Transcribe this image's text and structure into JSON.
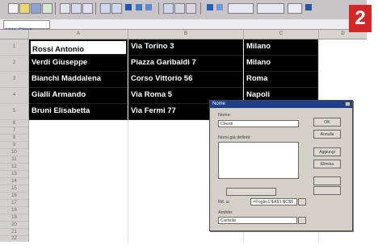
{
  "window": {
    "name_box": "Lista_Clienti"
  },
  "badge": "2",
  "columns": [
    "A",
    "B",
    "C",
    "D"
  ],
  "rows": [
    {
      "num": "1",
      "name": "Rossi Antonio",
      "address": "Via Torino 3",
      "city": "Milano"
    },
    {
      "num": "2",
      "name": "Verdi Giuseppe",
      "address": "Piazza Garibaldi 7",
      "city": "Milano"
    },
    {
      "num": "3",
      "name": "Bianchi Maddalena",
      "address": "Corso Vittorio 56",
      "city": "Roma"
    },
    {
      "num": "4",
      "name": "Gialli Armando",
      "address": "Via Roma 5",
      "city": "Napoli"
    },
    {
      "num": "5",
      "name": "Bruni Elisabetta",
      "address": "Via Fermi 77",
      "city": ""
    }
  ],
  "row_numbers": [
    "6",
    "7",
    "8",
    "9",
    "10",
    "11",
    "12",
    "13",
    "14",
    "15",
    "16",
    "17",
    "18",
    "19",
    "20",
    "21",
    "22"
  ],
  "dialog": {
    "title": "Nome",
    "name_label": "Nome:",
    "name_value": "Clienti",
    "list_label": "Nomi già definiti:",
    "ok": "OK",
    "cancel": "Annulla",
    "add": "Aggiungi",
    "delete": "Elimina",
    "range_label": "Rif. a:",
    "range_value": "=Foglio1!$A$1:$C$5",
    "scope_label": "Ambito:",
    "scope_value": "Cartella"
  }
}
